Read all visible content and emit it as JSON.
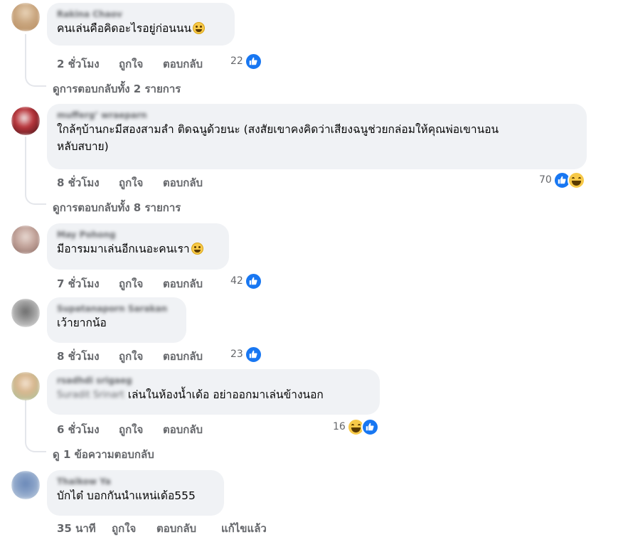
{
  "comments": [
    {
      "author": "Rakina Chaov",
      "text": "คนเล่นคือคิดอะไรอยู่ก่อนนน",
      "emoji": "grinning-sweat-emoji",
      "time": "2 ชั่วโมง",
      "like": "ถูกใจ",
      "reply": "ตอบกลับ",
      "reaction_count": "22",
      "reactions": [
        "like"
      ],
      "view_replies": "ดูการตอบกลับทั้ง 2 รายการ"
    },
    {
      "author": "mufferg’ wraeparn",
      "text": "ใกล้ๆบ้านกะมีสองสามลำ ติดฉนูด้วยนะ (สงสัยเขาคงคิดว่าเสียงฉนูช่วยกล่อมให้คุณพ่อเขานอน\nหลับสบาย)",
      "time": "8 ชั่วโมง",
      "like": "ถูกใจ",
      "reply": "ตอบกลับ",
      "reaction_count": "70",
      "reactions": [
        "like",
        "haha"
      ],
      "view_replies": "ดูการตอบกลับทั้ง 8 รายการ"
    },
    {
      "author": "May Pohong",
      "text": "มีอารมมาเล่นอีกเนอะคนเรา",
      "emoji": "relieved-emoji",
      "time": "7 ชั่วโมง",
      "like": "ถูกใจ",
      "reply": "ตอบกลับ",
      "reaction_count": "42",
      "reactions": [
        "like"
      ]
    },
    {
      "author": "Supatanaporn Sarakan",
      "text": "เว้ายากน้อ",
      "time": "8 ชั่วโมง",
      "like": "ถูกใจ",
      "reply": "ตอบกลับ",
      "reaction_count": "23",
      "reactions": [
        "like"
      ]
    },
    {
      "author": "rsadhdi srigaeg",
      "mention": "Suradit Srinart",
      "text": " เล่นในห้องน้ำเด้อ อย่าออกมาเล่นข้างนอก",
      "time": "6 ชั่วโมง",
      "like": "ถูกใจ",
      "reply": "ตอบกลับ",
      "reaction_count": "16",
      "reactions": [
        "haha",
        "like"
      ],
      "view_replies": "ดู 1 ข้อความตอบกลับ"
    },
    {
      "author": "Thaikow Ya",
      "text": "บักไต๋ บอกกันนำแหน่เด้อ555",
      "time": "35 นาที",
      "like": "ถูกใจ",
      "reply": "ตอบกลับ",
      "edited": "แก้ไขแล้ว"
    }
  ],
  "colors": {
    "bubble": "#f0f2f5",
    "meta": "#65676b",
    "like_blue": "#1877f2"
  }
}
